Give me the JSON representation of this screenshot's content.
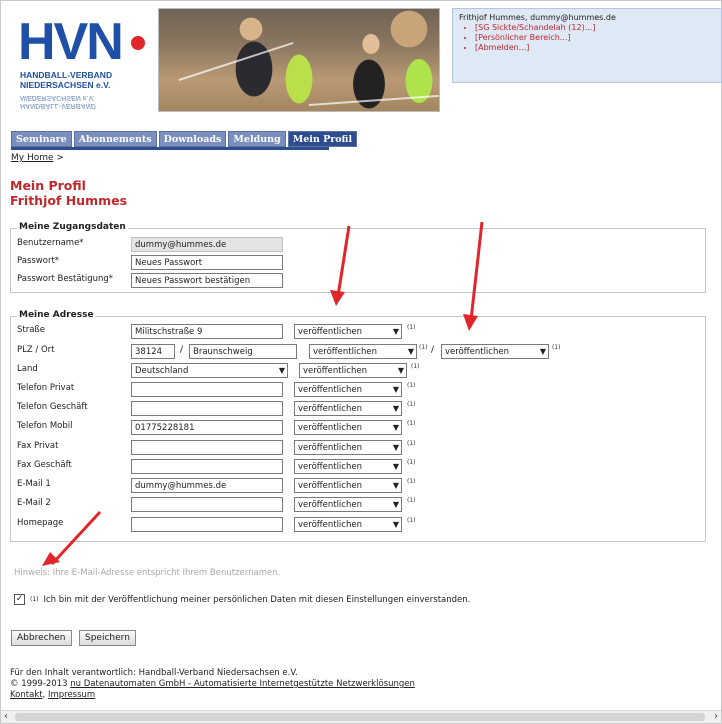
{
  "logo": {
    "main": "HVN",
    "line1": "HANDBALL-VERBAND",
    "line2": "NIEDERSACHSEN e.V."
  },
  "user": {
    "name": "Frithjof Hummes, dummy@hummes.de",
    "links": [
      "[SG Sickte/Schandelah (12)...]",
      "[Persönlicher Bereich...]",
      "[Abmelden...]"
    ]
  },
  "nav": [
    "Seminare",
    "Abonnements",
    "Downloads",
    "Meldung",
    "Mein Profil"
  ],
  "breadcrumb": {
    "home": "My Home",
    "sep": ">"
  },
  "page": {
    "title": "Mein Profil",
    "subtitle": "Frithjof Hummes"
  },
  "access": {
    "legend": "Meine Zugangsdaten",
    "username_label": "Benutzername*",
    "username_value": "dummy@hummes.de",
    "password_label": "Passwort*",
    "password_value": "Neues Passwort",
    "password_confirm_label": "Passwort Bestätigung*",
    "password_confirm_value": "Neues Passwort bestätigen"
  },
  "address": {
    "legend": "Meine Adresse",
    "street_label": "Straße",
    "street_value": "Militschstraße 9",
    "plz_label": "PLZ / Ort",
    "plz_value": "38124",
    "city_value": "Braunschweig",
    "land_label": "Land",
    "land_value": "Deutschland",
    "phone_private_label": "Telefon Privat",
    "phone_private_value": "",
    "phone_business_label": "Telefon Geschäft",
    "phone_business_value": "",
    "phone_mobile_label": "Telefon Mobil",
    "phone_mobile_value": "01775228181",
    "fax_private_label": "Fax Privat",
    "fax_private_value": "",
    "fax_business_label": "Fax Geschäft",
    "fax_business_value": "",
    "email1_label": "E-Mail 1",
    "email1_value": "dummy@hummes.de",
    "email2_label": "E-Mail 2",
    "email2_value": "",
    "homepage_label": "Homepage",
    "homepage_value": "",
    "publish_option": "veröffentlichen",
    "footnote": "(1)",
    "slash": "/"
  },
  "hint": "Hinweis: Ihre E-Mail-Adresse entspricht Ihrem Benutzernamen.",
  "consent": {
    "footnote": "(1)",
    "text": "Ich bin mit der Veröffentlichung meiner persönlichen Daten mit diesen Einstellungen einverstanden.",
    "checked_mark": "✓"
  },
  "buttons": {
    "cancel": "Abbrechen",
    "save": "Speichern"
  },
  "footer": {
    "line1": "Für den Inhalt verantwortlich: Handball-Verband Niedersachsen e.V.",
    "copyright": "© 1999-2013",
    "company_link": "nu Datenautomaten GmbH - Automatisierte Internetgestützte Netzwerklösungen",
    "kontakt": "Kontakt",
    "sep": ",",
    "impressum": "Impressum"
  },
  "colors": {
    "accent_red": "#c0282d",
    "nav_blue": "#7a8fbe",
    "nav_active": "#2d4d8f",
    "annotation_arrow": "#e0262b"
  }
}
